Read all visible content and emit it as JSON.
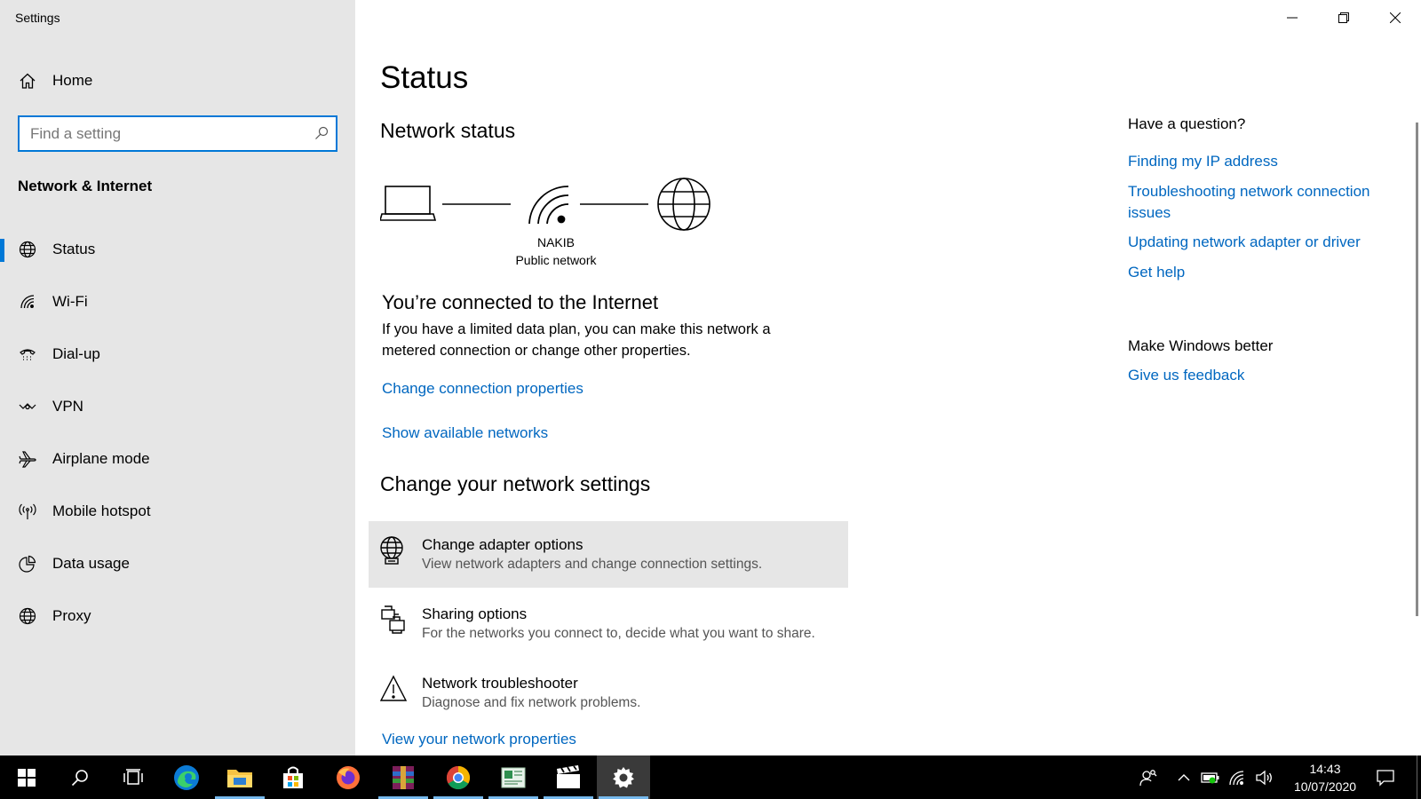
{
  "window": {
    "title": "Settings"
  },
  "sidebar": {
    "home_label": "Home",
    "search_placeholder": "Find a setting",
    "section_title": "Network & Internet",
    "items": [
      {
        "label": "Status",
        "icon": "globe-icon",
        "active": true
      },
      {
        "label": "Wi-Fi",
        "icon": "wifi-icon"
      },
      {
        "label": "Dial-up",
        "icon": "dialup-icon"
      },
      {
        "label": "VPN",
        "icon": "vpn-icon"
      },
      {
        "label": "Airplane mode",
        "icon": "airplane-icon"
      },
      {
        "label": "Mobile hotspot",
        "icon": "hotspot-icon"
      },
      {
        "label": "Data usage",
        "icon": "data-usage-icon"
      },
      {
        "label": "Proxy",
        "icon": "globe-icon"
      }
    ]
  },
  "main": {
    "title": "Status",
    "network_status_heading": "Network status",
    "network_name": "NAKIB",
    "network_type": "Public network",
    "connected_heading": "You’re connected to the Internet",
    "connected_description": "If you have a limited data plan, you can make this network a metered connection or change other properties.",
    "change_connection_link": "Change connection properties",
    "show_networks_link": "Show available networks",
    "change_settings_heading": "Change your network settings",
    "options": [
      {
        "title": "Change adapter options",
        "description": "View network adapters and change connection settings.",
        "icon": "adapter-icon"
      },
      {
        "title": "Sharing options",
        "description": "For the networks you connect to, decide what you want to share.",
        "icon": "sharing-icon"
      },
      {
        "title": "Network troubleshooter",
        "description": "Diagnose and fix network problems.",
        "icon": "warning-icon"
      }
    ],
    "view_properties_link": "View your network properties"
  },
  "help": {
    "question_heading": "Have a question?",
    "links": [
      "Finding my IP address",
      "Troubleshooting network connection issues",
      "Updating network adapter or driver",
      "Get help"
    ],
    "feedback_heading": "Make Windows better",
    "feedback_link": "Give us feedback"
  },
  "taskbar": {
    "apps": [
      "start-icon",
      "search-icon",
      "task-view-icon",
      "edge-icon",
      "file-explorer-icon",
      "store-icon",
      "firefox-icon",
      "winrar-icon",
      "chrome-icon",
      "app-icon",
      "video-editor-icon",
      "settings-icon"
    ],
    "time": "14:43",
    "date": "10/07/2020"
  },
  "colors": {
    "accent": "#0078d7",
    "link": "#0067c0",
    "sidebar_bg": "#e6e6e6",
    "taskbar_bg": "#000000"
  }
}
